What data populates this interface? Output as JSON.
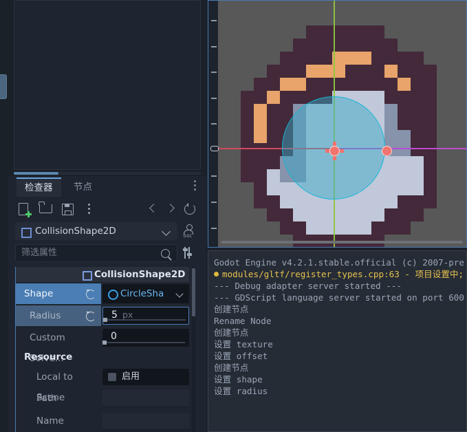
{
  "left_dock": {
    "scene_panel": {
      "name": "scene-tree-panel",
      "content": ""
    },
    "tabs": [
      {
        "id": "inspector",
        "label": "检查器",
        "active": true
      },
      {
        "id": "node",
        "label": "节点",
        "active": false
      }
    ],
    "toolbar": [
      {
        "id": "new-resource",
        "icon": "new-resource-icon"
      },
      {
        "id": "open-resource",
        "icon": "folder-icon"
      },
      {
        "id": "save-resource",
        "icon": "save-icon"
      },
      {
        "id": "more-options",
        "icon": "vertical-dots-icon"
      },
      {
        "id": "history-prev",
        "icon": "chevron-left-icon"
      },
      {
        "id": "history-next",
        "icon": "chevron-right-icon"
      },
      {
        "id": "history",
        "icon": "history-icon"
      }
    ],
    "node_selector": {
      "label": "CollisionShape2D",
      "icon": "collisionshape2d-icon"
    },
    "doc_button": {
      "label": "DOC",
      "icon": "open-docs-icon"
    },
    "filter": {
      "placeholder": "筛选属性",
      "value": "",
      "search_icon": "search-icon",
      "tools_icon": "object-tools-icon"
    },
    "property_header": {
      "title": "CollisionShape2D"
    },
    "properties": [
      {
        "name": "Shape",
        "type": "resource",
        "value": "CircleSha",
        "highlight": "strong",
        "revert": true
      },
      {
        "name": "Radius",
        "type": "number",
        "value": "5",
        "unit": "px",
        "highlight": "soft",
        "revert": true
      },
      {
        "name": "Custom Solve...",
        "type": "number",
        "value": "0",
        "unit": "",
        "highlight": "none",
        "revert": false
      },
      {
        "name": "Resource",
        "type": "section"
      },
      {
        "name": "Local to Scene",
        "type": "checkbox",
        "value": "启用",
        "checked": false
      },
      {
        "name": "Path",
        "type": "text",
        "value": ""
      },
      {
        "name": "Name",
        "type": "text",
        "value": ""
      }
    ]
  },
  "viewport": {
    "name": "2d-viewport",
    "background": "#585858",
    "axis_v_color": "#8ec63f",
    "axis_h_color": "#d04a5e",
    "shape_color": "#17b6d6",
    "handles": [
      "center-pivot-handle",
      "radius-handle"
    ],
    "sprite": {
      "palette": {
        "hair": "#43293a",
        "highlight": "#e8a46a",
        "skin": "#c0c8da",
        "shade": "#8792ab",
        "bg": "#585858"
      }
    }
  },
  "output": {
    "name": "output-console",
    "lines": [
      {
        "text": "Godot Engine v4.2.1.stable.official (c) 2007-pre",
        "kind": "info"
      },
      {
        "text": "modules/gltf/register_types.cpp:63 - 项目设置中;",
        "kind": "warn"
      },
      {
        "text": "--- Debug adapter server started ---",
        "kind": "info"
      },
      {
        "text": "--- GDScript language server started on port 600",
        "kind": "info"
      },
      {
        "text": "创建节点",
        "kind": "info"
      },
      {
        "text": "Rename Node",
        "kind": "info"
      },
      {
        "text": "创建节点",
        "kind": "info"
      },
      {
        "text": "设置 texture",
        "kind": "info"
      },
      {
        "text": "设置 offset",
        "kind": "info"
      },
      {
        "text": "创建节点",
        "kind": "info"
      },
      {
        "text": "设置 shape",
        "kind": "info"
      },
      {
        "text": "设置 radius",
        "kind": "info"
      }
    ]
  }
}
